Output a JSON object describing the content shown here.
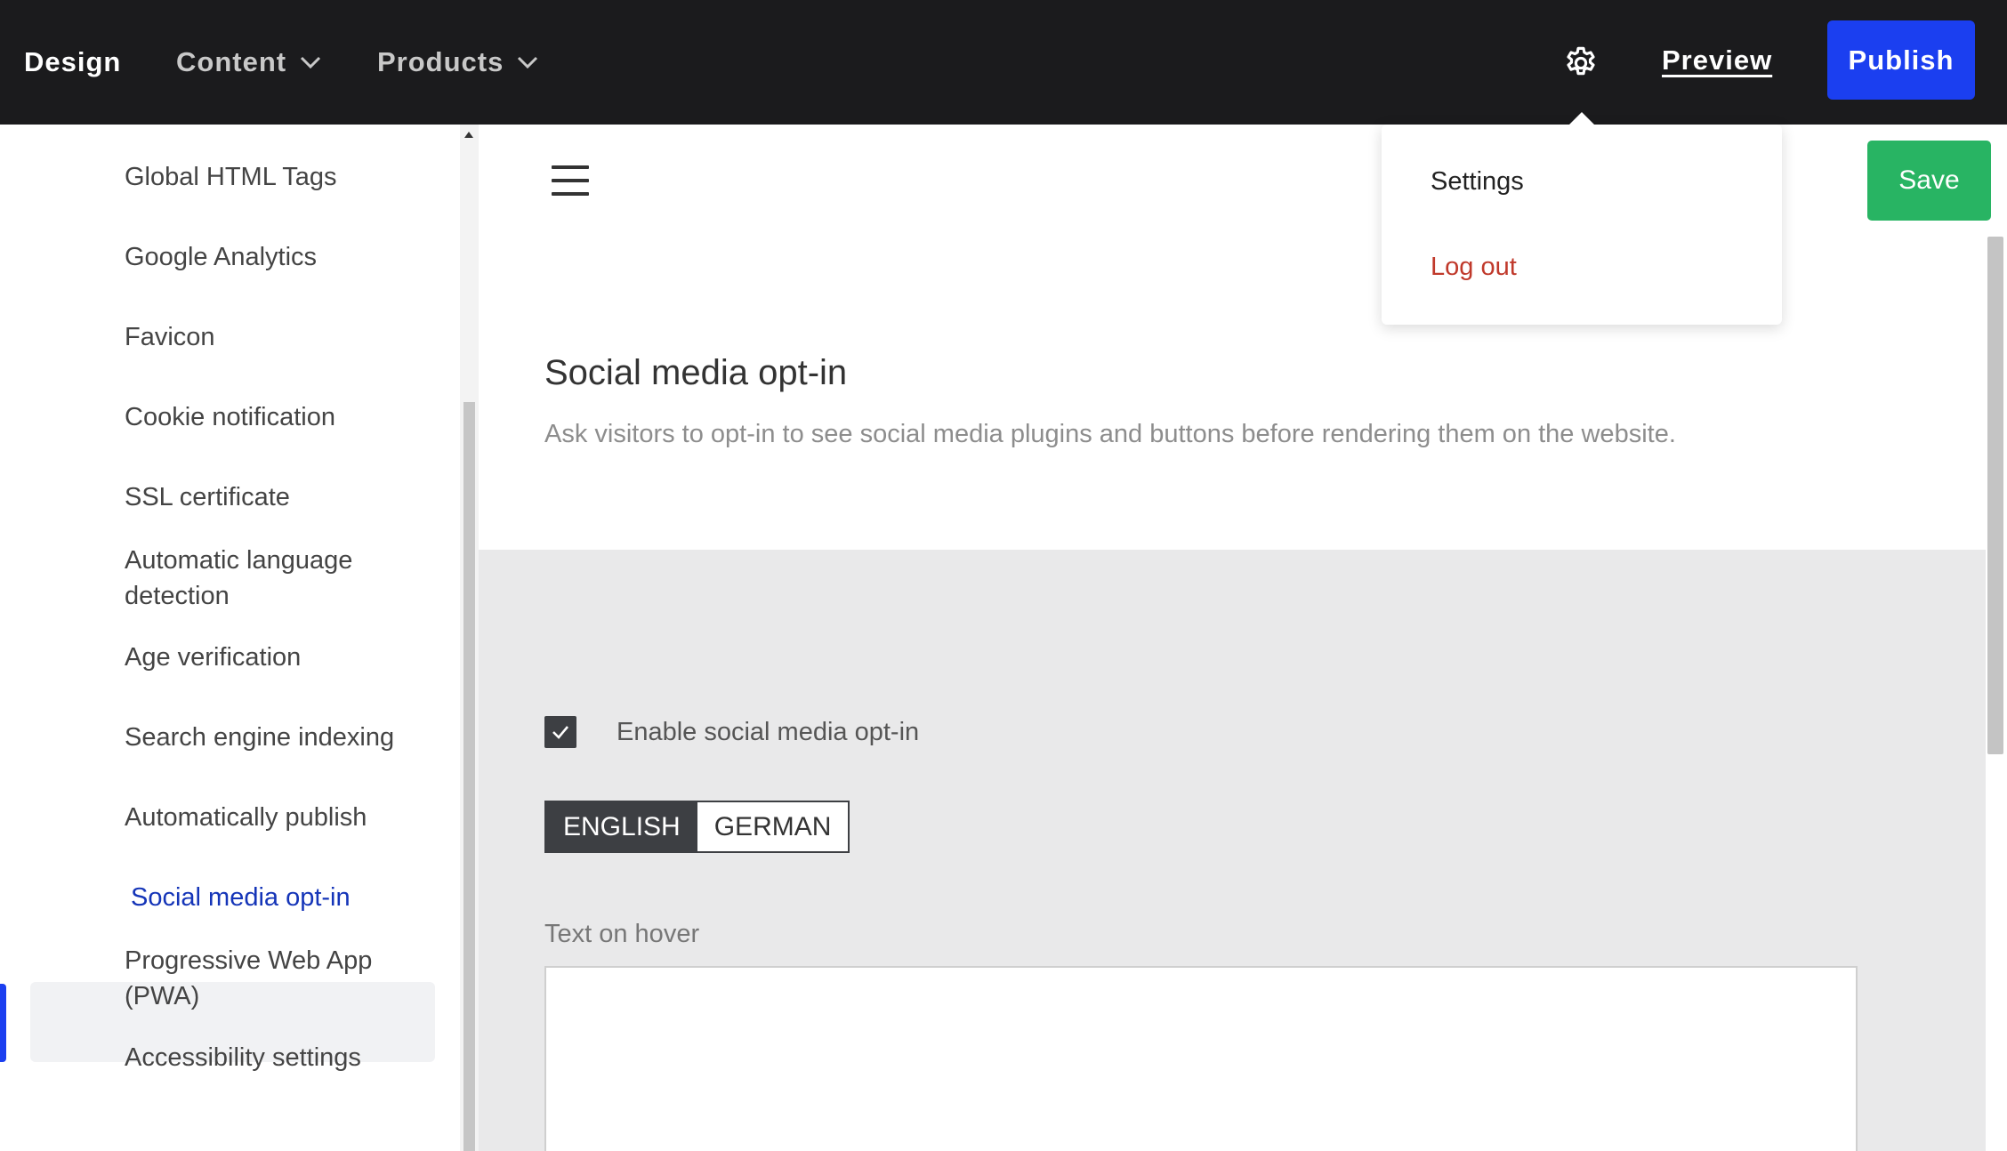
{
  "topbar": {
    "design": "Design",
    "content": "Content",
    "products": "Products",
    "preview": "Preview",
    "publish": "Publish"
  },
  "dropdown": {
    "settings": "Settings",
    "logout": "Log out"
  },
  "sidebar": {
    "items": [
      "Global HTML Tags",
      "Google Analytics",
      "Favicon",
      "Cookie notification",
      "SSL certificate",
      "Automatic language detection",
      "Age verification",
      "Search engine indexing",
      "Automatically publish",
      "Social media opt-in",
      "Progressive Web App (PWA)",
      "Accessibility settings"
    ],
    "active": "Social media opt-in"
  },
  "main": {
    "save": "Save",
    "title": "Social media opt-in",
    "description": "Ask visitors to opt-in to see social media plugins and buttons before rendering them on the website.",
    "enable_label": "Enable social media opt-in",
    "enable_checked": true,
    "lang_tabs": [
      "ENGLISH",
      "GERMAN"
    ],
    "active_lang": "ENGLISH",
    "text_on_hover_label": "Text on hover",
    "text_on_hover_value": ""
  },
  "colors": {
    "topbar": "#1b1b1d",
    "publish": "#1b3ff0",
    "save": "#28b463",
    "active_link": "#1535b8",
    "logout": "#c0392b"
  }
}
